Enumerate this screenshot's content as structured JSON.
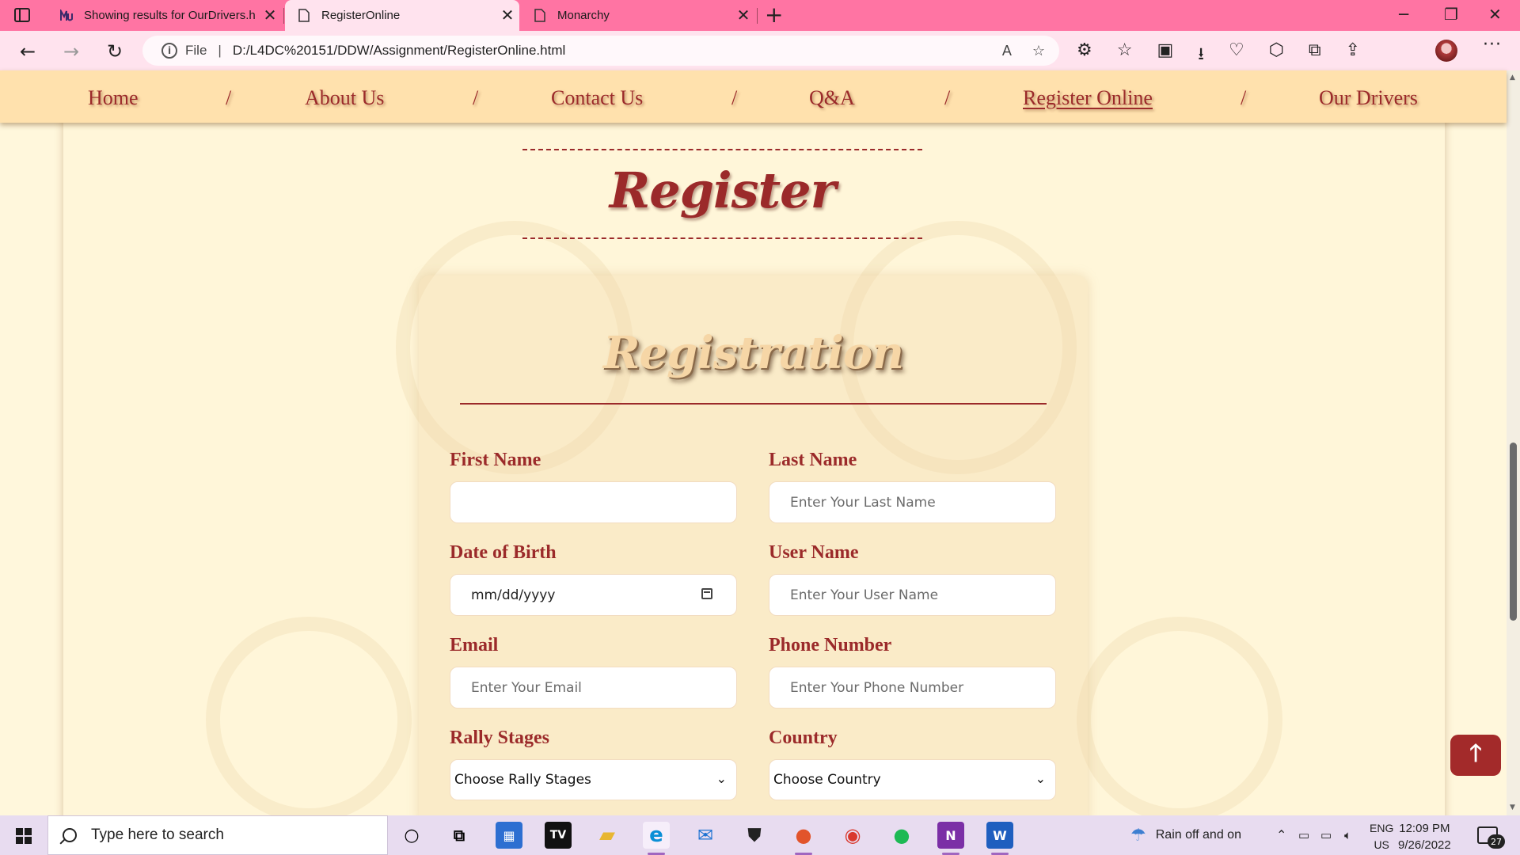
{
  "browser": {
    "tabs": [
      {
        "title": "Showing results for OurDrivers.h",
        "favicon": "mu-logo-icon",
        "active": false
      },
      {
        "title": "RegisterOnline",
        "favicon": "page-icon",
        "active": true
      },
      {
        "title": "Monarchy",
        "favicon": "page-icon",
        "active": false
      }
    ],
    "address": {
      "scheme_label": "File",
      "url": "D:/L4DC%20151/DDW/Assignment/RegisterOnline.html"
    }
  },
  "nav": {
    "items": [
      "Home",
      "About Us",
      "Contact Us",
      "Q&A",
      "Register Online",
      "Our Drivers"
    ],
    "separator": "/",
    "current": "Register Online"
  },
  "page": {
    "title": "Register",
    "form_title": "Registration"
  },
  "form": {
    "first_name": {
      "label": "First Name",
      "value": "",
      "placeholder": ""
    },
    "last_name": {
      "label": "Last Name",
      "placeholder": "Enter Your Last Name"
    },
    "dob": {
      "label": "Date of Birth",
      "placeholder": "mm/dd/yyyy"
    },
    "user_name": {
      "label": "User Name",
      "placeholder": "Enter Your User Name"
    },
    "email": {
      "label": "Email",
      "placeholder": "Enter Your Email"
    },
    "phone": {
      "label": "Phone Number",
      "placeholder": "Enter Your Phone Number"
    },
    "rally_stages": {
      "label": "Rally Stages",
      "selected": "Choose Rally Stages"
    },
    "country": {
      "label": "Country",
      "selected": "Choose Country"
    }
  },
  "back_to_top": {
    "icon": "arrow-up-icon",
    "glyph": "🡑"
  },
  "taskbar": {
    "search_placeholder": "Type here to search",
    "weather": "Rain off and on",
    "lang_top": "ENG",
    "lang_bottom": "US",
    "time": "12:09 PM",
    "date": "9/26/2022",
    "notifications": "27"
  },
  "colors": {
    "tabstrip": "#ff74a3",
    "toolbar": "#ffe3ee",
    "navbar": "#ffe1ad",
    "accent": "#9b2a2a",
    "page_bg": "#fff7dc"
  }
}
